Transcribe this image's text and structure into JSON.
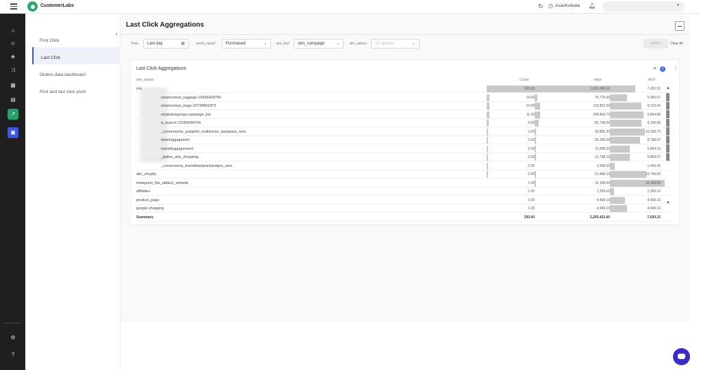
{
  "app": {
    "logo_text": "CustomerLabs"
  },
  "topbar": {
    "timezone": "Asia/Kolkata"
  },
  "rail": {
    "items": [
      {
        "icon": "home-icon"
      },
      {
        "icon": "users-icon"
      },
      {
        "icon": "layers-icon"
      },
      {
        "icon": "share-icon"
      },
      {
        "icon": "table-icon"
      },
      {
        "icon": "document-icon"
      },
      {
        "icon": "chart-icon",
        "active": "green"
      },
      {
        "icon": "grid-icon",
        "active": "blue"
      }
    ],
    "bottom": [
      {
        "icon": "settings-icon"
      },
      {
        "icon": "help-icon"
      }
    ]
  },
  "subnav": {
    "items": [
      {
        "label": "First Click"
      },
      {
        "label": "Last Click",
        "active": true
      },
      {
        "label": "Orders data dashboard"
      },
      {
        "label": "First and last click pivot"
      }
    ]
  },
  "page": {
    "title": "Last Click Aggregations"
  },
  "filters": {
    "time_label": "Time",
    "time_value": "Last day",
    "event_label": "event_name*",
    "event_value": "Purchased",
    "utmkey_label": "utm_key*",
    "utmkey_value": "utm_campaign",
    "utmvalues_label": "utm_values",
    "utmvalues_placeholder": "22 options",
    "apply_label": "APPLY",
    "clear_label": "Clear All"
  },
  "card": {
    "title": "Last Click Aggregations",
    "filter_count": "2",
    "columns": {
      "name": "utm_values",
      "count": "Count",
      "value": "value",
      "aov": "AOV"
    },
    "rows": [
      {
        "name": "n/a",
        "count": "220.00",
        "value": "1,626,245.15",
        "aov": "7,392.02",
        "count_frac": 1.0,
        "value_frac": 1.0,
        "aov_frac": 0.46
      },
      {
        "name": "omancemax_luggage-15566428750",
        "count": "14.00",
        "value": "70,779.35",
        "aov": "5,055.67",
        "count_frac": 0.06,
        "value_frac": 0.04,
        "aov_frac": 0.31
      },
      {
        "name": "omancemax_bags-20728801873",
        "count": "13.00",
        "value": "119,852.50",
        "aov": "9,219.42",
        "count_frac": 0.06,
        "value_frac": 0.07,
        "aov_frac": 0.57
      },
      {
        "name": "onlabshopping+campaign_list",
        "count": "11.00",
        "value": "108,403.70",
        "aov": "9,854.88",
        "count_frac": 0.05,
        "value_frac": 0.07,
        "aov_frac": 0.61
      },
      {
        "name": "d_search-12285548794",
        "count": "9.00",
        "value": "82,798.65",
        "aov": "9,199.85",
        "count_frac": 0.04,
        "value_frac": 0.05,
        "aov_frac": 0.57
      },
      {
        "name": "_conversions_autopilot_multiverse_backpack_new",
        "count": "3.00",
        "value": "30,806.20",
        "aov": "10,268.73",
        "count_frac": 0.01,
        "value_frac": 0.02,
        "aov_frac": 0.64
      },
      {
        "name": "dokeluggagesetn",
        "count": "3.00",
        "value": "26,396.00",
        "aov": "8,798.67",
        "count_frac": 0.01,
        "value_frac": 0.02,
        "aov_frac": 0.55
      },
      {
        "name": "transitluggagenew2",
        "count": "2.00",
        "value": "11,608.20",
        "aov": "5,804.10",
        "count_frac": 0.01,
        "value_frac": 0.01,
        "aov_frac": 0.36
      },
      {
        "name": "_ladies_adv_shopping",
        "count": "2.00",
        "value": "11,738.15",
        "aov": "5,869.07",
        "count_frac": 0.01,
        "value_frac": 0.01,
        "aov_frac": 0.36
      },
      {
        "name": "_conversions_transitbackpackandpro_new",
        "count": "2.00",
        "value": "2,998.00",
        "aov": "1,499.00",
        "count_frac": 0.01,
        "value_frac": 0.0,
        "aov_frac": 0.09
      },
      {
        "name": "abc_shopify",
        "count": "2.00",
        "value": "21,498.10",
        "aov": "10,749.05",
        "count_frac": 0.01,
        "value_frac": 0.01,
        "aov_frac": 0.66
      },
      {
        "name": "instagram_the_abbie2_website",
        "count": "1.00",
        "value": "16,198.00",
        "aov": "16,198.00",
        "count_frac": 0.0,
        "value_frac": 0.01,
        "aov_frac": 1.0
      },
      {
        "name": "affiliates",
        "count": "1.00",
        "value": "1,259.10",
        "aov": "1,259.10",
        "count_frac": 0.0,
        "value_frac": 0.0,
        "aov_frac": 0.08
      },
      {
        "name": "product_page",
        "count": "1.00",
        "value": "4,499.10",
        "aov": "4,499.10",
        "count_frac": 0.0,
        "value_frac": 0.0,
        "aov_frac": 0.28
      },
      {
        "name": "google shopping",
        "count": "1.00",
        "value": "4,949.10",
        "aov": "4,949.10",
        "count_frac": 0.0,
        "value_frac": 0.0,
        "aov_frac": 0.31
      }
    ],
    "summary": {
      "label": "Summary",
      "count": "293.00",
      "value": "2,203,421.60",
      "aov": "7,520.21"
    }
  },
  "colors": {
    "accent": "#3a57e8",
    "active_green": "#22a36a",
    "chat": "#3b2cc9",
    "bar": "#c9c9c9"
  }
}
